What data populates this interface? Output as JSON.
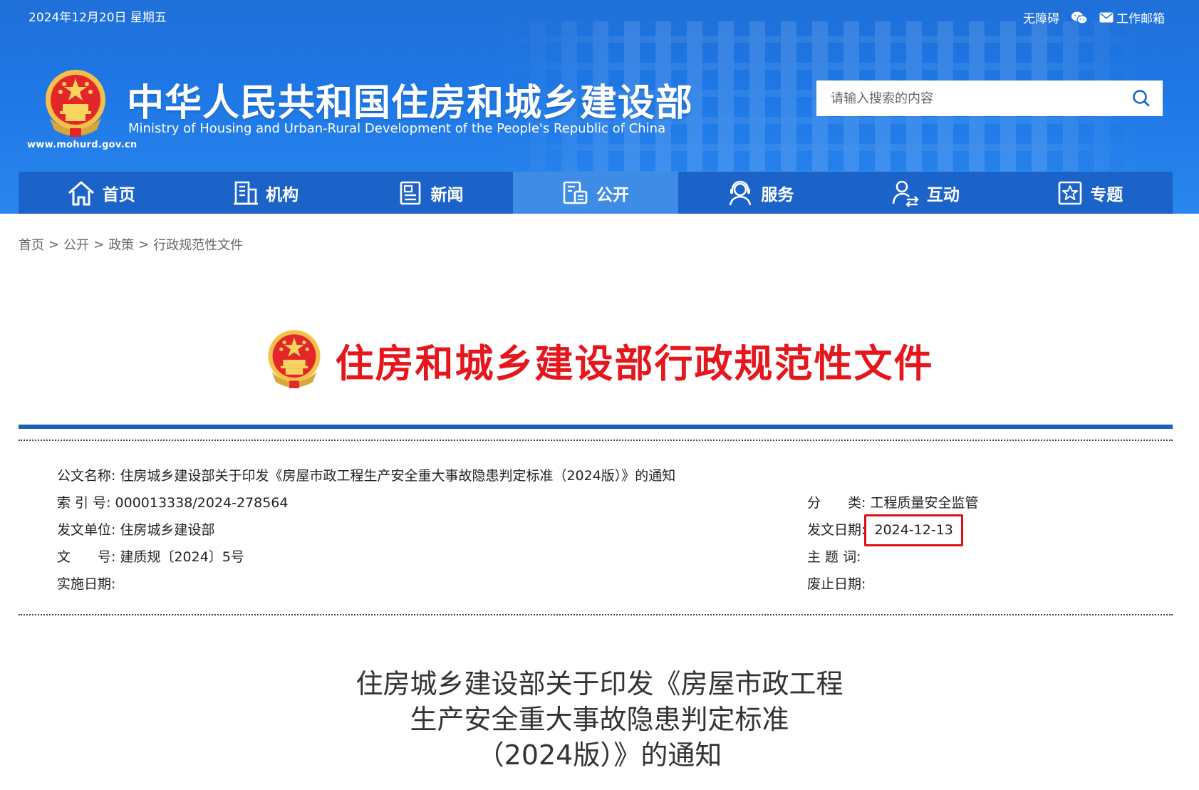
{
  "header": {
    "date": "2024年12月20日 星期五",
    "links": {
      "accessibility": "无障碍",
      "mailbox": "工作邮箱"
    },
    "site_name_cn": "中华人民共和国住房和城乡建设部",
    "site_name_en": "Ministry of Housing and Urban-Rural Development of the People's Republic of China",
    "site_url": "www.mohurd.gov.cn",
    "search_placeholder": "请输入搜索的内容"
  },
  "nav": {
    "items": [
      {
        "label": "首页",
        "icon": "home-icon"
      },
      {
        "label": "机构",
        "icon": "building-icon"
      },
      {
        "label": "新闻",
        "icon": "news-icon"
      },
      {
        "label": "公开",
        "icon": "disclosure-icon",
        "active": true
      },
      {
        "label": "服务",
        "icon": "service-icon"
      },
      {
        "label": "互动",
        "icon": "interaction-icon"
      },
      {
        "label": "专题",
        "icon": "topic-icon"
      }
    ]
  },
  "breadcrumb": [
    "首页",
    "公开",
    "政策",
    "行政规范性文件"
  ],
  "banner": {
    "title": "住房和城乡建设部行政规范性文件"
  },
  "meta": {
    "doc_name_label": "公文名称:",
    "doc_name": "住房城乡建设部关于印发《房屋市政工程生产安全重大事故隐患判定标准（2024版）》的通知",
    "index_label": "索 引 号:",
    "index": "000013338/2024-278564",
    "unit_label": "发文单位:",
    "unit": "住房城乡建设部",
    "docno_label": "文　　号:",
    "docno": "建质规〔2024〕5号",
    "impl_label": "实施日期:",
    "impl": "",
    "category_label": "分　　类:",
    "category": "工程质量安全监管",
    "date_label": "发文日期:",
    "date": "2024-12-13",
    "keywords_label": "主 题 词:",
    "keywords": "",
    "abolish_label": "废止日期:",
    "abolish": ""
  },
  "document": {
    "title_lines": [
      "住房城乡建设部关于印发《房屋市政工程",
      "生产安全重大事故隐患判定标准",
      "（2024版）》的通知"
    ]
  },
  "colors": {
    "header_blue": "#1e78e6",
    "nav_blue": "#1c63c9",
    "nav_active": "#3e8ce6",
    "banner_red": "#e5161c",
    "highlight_red": "#e10f14"
  }
}
